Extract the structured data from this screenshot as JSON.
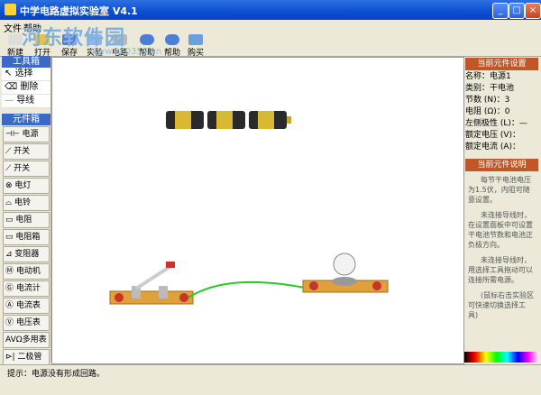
{
  "window": {
    "title": "中学电路虚拟实验室 V4.1"
  },
  "menu": [
    "文件",
    "帮助"
  ],
  "toolbar": [
    "新建",
    "打开",
    "保存",
    "实验图",
    "电路图",
    "帮助",
    "帮助",
    "购买"
  ],
  "watermark": {
    "text": "河东软件园",
    "url": "www.pc0359.cn"
  },
  "toolbox": {
    "title": "工具箱",
    "items": [
      "选择",
      "删除",
      "导线"
    ]
  },
  "components": {
    "title": "元件箱",
    "items": [
      "电源",
      "开关",
      "开关",
      "电灯",
      "电铃",
      "电阻",
      "电阻箱",
      "变阻器",
      "电动机",
      "电流计",
      "电流表",
      "电压表",
      "多用表",
      "二极管"
    ]
  },
  "properties": {
    "title": "当前元件设置",
    "rows": [
      "名称：电源1",
      "类别：干电池",
      "节数 (N)：3",
      "电阻 (Ω)：0",
      "左侧极性 (L)：—",
      "额定电压 (V)：",
      "额定电流 (A)："
    ]
  },
  "description": {
    "title": "当前元件说明",
    "paragraphs": [
      "每节干电池电压为1.5伏，内阻可随意设置。",
      "未连接导线时，在设置面板中可设置干电池节数和电池正负极方向。",
      "未连接导线时，用选择工具拖动可以连接所需电源。",
      "(鼠标右击实验区可快速切换选择工具)"
    ]
  },
  "status": {
    "text": "提示：电源没有形成回路。"
  },
  "colors": {
    "titlebar": "#0b4fd1",
    "panel_head": "#3a69c9",
    "section_head": "#c0572b",
    "wire": "#22cc22"
  }
}
